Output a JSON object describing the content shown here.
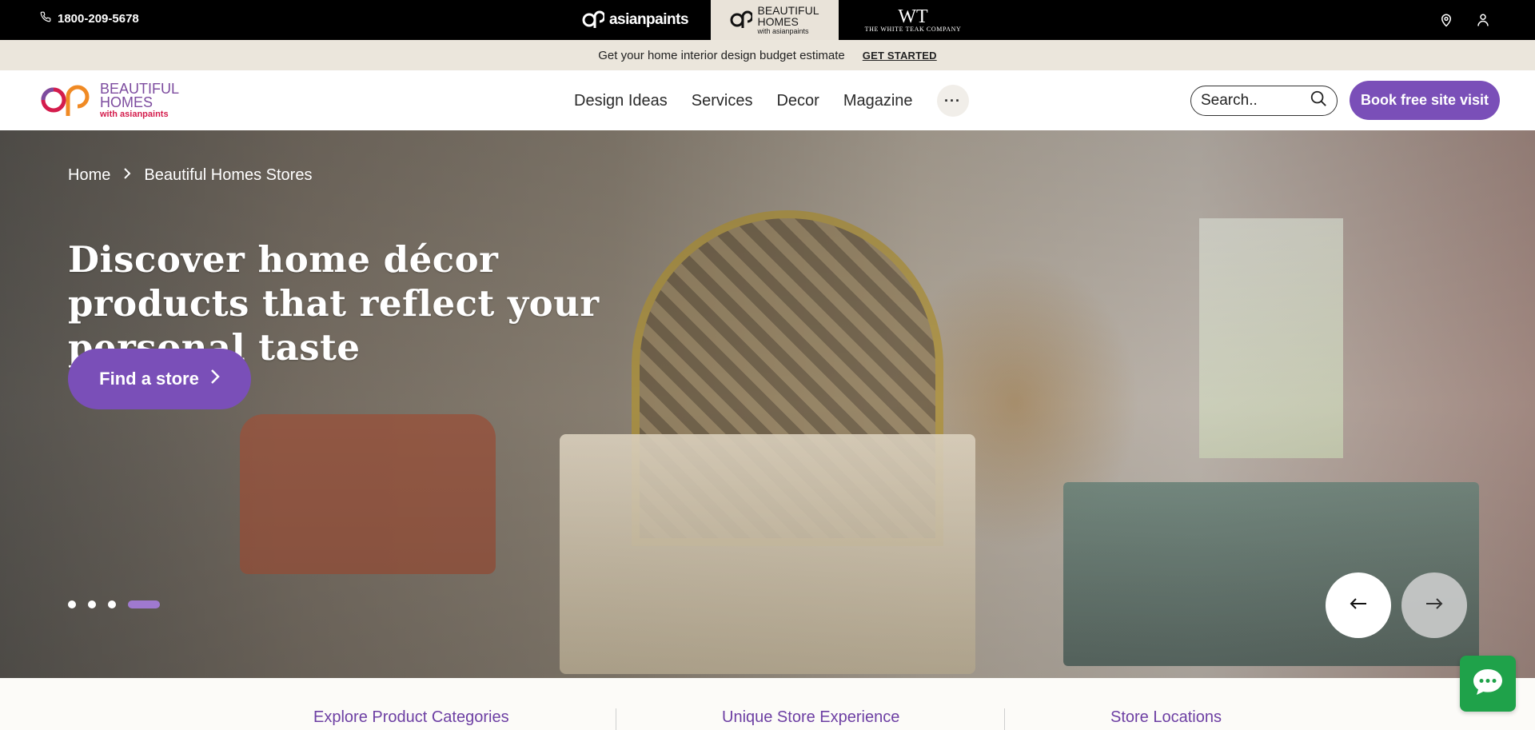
{
  "topbar": {
    "phone": "1800-209-5678",
    "brands": {
      "asianpaints": "asianpaints",
      "beautiful_homes_line1": "BEAUTIFUL",
      "beautiful_homes_line2": "HOMES",
      "beautiful_homes_sub": "with asianpaints",
      "white_teak_mono": "WT",
      "white_teak_name": "THE WHITE TEAK COMPANY"
    },
    "icons": [
      "location-icon",
      "user-icon"
    ]
  },
  "promo": {
    "text": "Get your home interior design budget estimate",
    "cta": "GET STARTED"
  },
  "header": {
    "logo_line1": "BEAUTIFUL",
    "logo_line2": "HOMES",
    "logo_sub": "with asianpaints",
    "nav": [
      "Design Ideas",
      "Services",
      "Decor",
      "Magazine"
    ],
    "more": "···",
    "search_placeholder": "Search..",
    "book_button": "Book free site visit"
  },
  "hero": {
    "breadcrumb": [
      "Home",
      "Beautiful Homes Stores"
    ],
    "title": "Discover home décor products that reflect your personal taste",
    "cta": "Find a store",
    "carousel": {
      "slides": 4,
      "active": 4
    }
  },
  "bottom_tabs": [
    "Explore Product Categories",
    "Unique Store Experience",
    "Store Locations"
  ],
  "colors": {
    "brand_purple": "#7a4fb8",
    "topbar_black": "#000000",
    "promo_beige": "#ebe6dc",
    "tab_text_purple": "#6d3fa3",
    "chat_green": "#1fa24a"
  }
}
